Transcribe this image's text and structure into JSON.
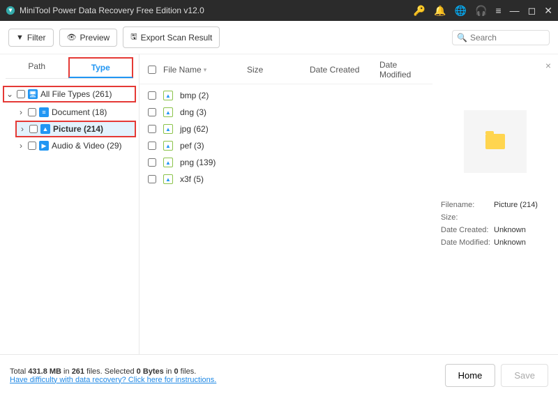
{
  "titlebar": {
    "title": "MiniTool Power Data Recovery Free Edition v12.0"
  },
  "toolbar": {
    "filter": "Filter",
    "preview": "Preview",
    "export": "Export Scan Result",
    "search_placeholder": "Search"
  },
  "tabs": {
    "path": "Path",
    "type": "Type"
  },
  "tree": {
    "root": {
      "label": "All File Types (261)"
    },
    "items": [
      {
        "label": "Document (18)",
        "icon": "doc"
      },
      {
        "label": "Picture (214)",
        "icon": "pic",
        "selected": true
      },
      {
        "label": "Audio & Video (29)",
        "icon": "av"
      }
    ]
  },
  "columns": {
    "name": "File Name",
    "size": "Size",
    "datec": "Date Created",
    "datem": "Date Modified"
  },
  "files": [
    {
      "name": "bmp (2)"
    },
    {
      "name": "dng (3)"
    },
    {
      "name": "jpg (62)"
    },
    {
      "name": "pef (3)"
    },
    {
      "name": "png (139)"
    },
    {
      "name": "x3f (5)"
    }
  ],
  "details": {
    "labels": {
      "filename": "Filename:",
      "size": "Size:",
      "datec": "Date Created:",
      "datem": "Date Modified:"
    },
    "values": {
      "filename": "Picture (214)",
      "size": "",
      "datec": "Unknown",
      "datem": "Unknown"
    }
  },
  "footer": {
    "line1_pre": "Total ",
    "line1_b1": "431.8 MB",
    "line1_mid1": " in ",
    "line1_b2": "261",
    "line1_mid2": " files.   Selected ",
    "line1_b3": "0 Bytes",
    "line1_mid3": " in ",
    "line1_b4": "0",
    "line1_post": " files.",
    "help": "Have difficulty with data recovery? Click here for instructions.",
    "home": "Home",
    "save": "Save"
  }
}
